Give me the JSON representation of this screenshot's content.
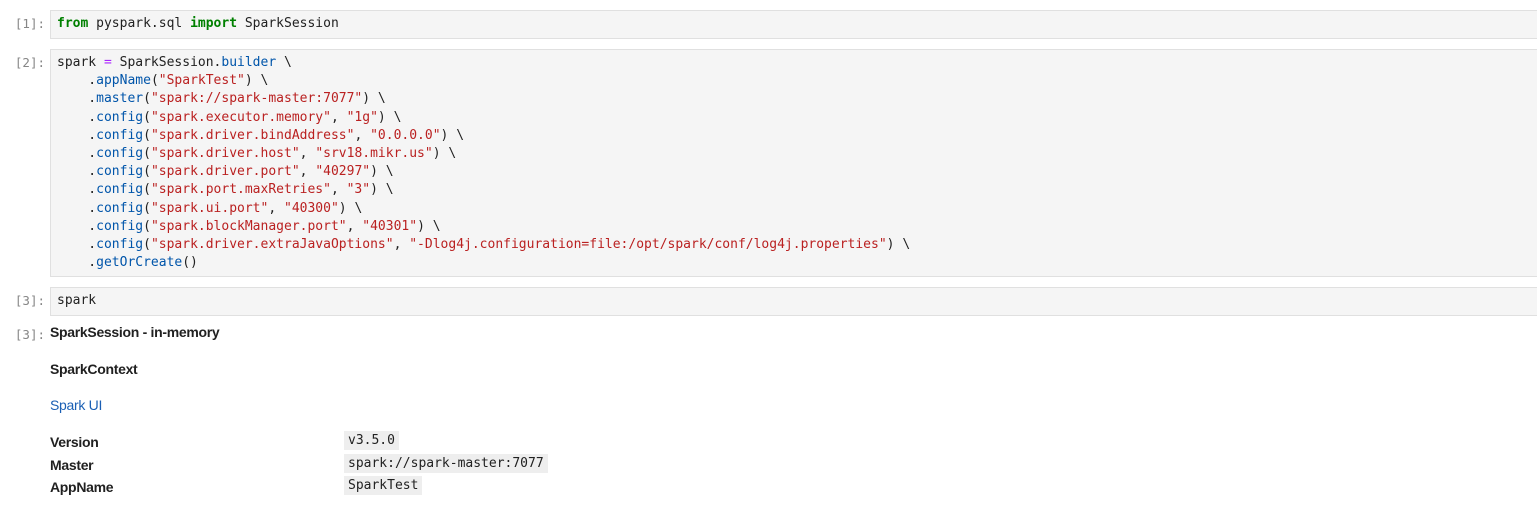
{
  "cells": [
    {
      "prompt": "[1]:",
      "tokens": [
        {
          "t": "kw",
          "v": "from"
        },
        {
          "t": "",
          "v": " pyspark.sql "
        },
        {
          "t": "kw",
          "v": "import"
        },
        {
          "t": "",
          "v": " SparkSession"
        }
      ]
    },
    {
      "prompt": "[2]:",
      "lines": [
        [
          {
            "t": "",
            "v": "spark "
          },
          {
            "t": "op",
            "v": "="
          },
          {
            "t": "",
            "v": " SparkSession."
          },
          {
            "t": "at",
            "v": "builder"
          },
          {
            "t": "",
            "v": " \\"
          }
        ],
        [
          {
            "t": "",
            "v": "    ."
          },
          {
            "t": "at",
            "v": "appName"
          },
          {
            "t": "",
            "v": "("
          },
          {
            "t": "st",
            "v": "\"SparkTest\""
          },
          {
            "t": "",
            "v": ") \\"
          }
        ],
        [
          {
            "t": "",
            "v": "    ."
          },
          {
            "t": "at",
            "v": "master"
          },
          {
            "t": "",
            "v": "("
          },
          {
            "t": "st",
            "v": "\"spark://spark-master:7077\""
          },
          {
            "t": "",
            "v": ") \\"
          }
        ],
        [
          {
            "t": "",
            "v": "    ."
          },
          {
            "t": "at",
            "v": "config"
          },
          {
            "t": "",
            "v": "("
          },
          {
            "t": "st",
            "v": "\"spark.executor.memory\""
          },
          {
            "t": "",
            "v": ", "
          },
          {
            "t": "st",
            "v": "\"1g\""
          },
          {
            "t": "",
            "v": ") \\"
          }
        ],
        [
          {
            "t": "",
            "v": "    ."
          },
          {
            "t": "at",
            "v": "config"
          },
          {
            "t": "",
            "v": "("
          },
          {
            "t": "st",
            "v": "\"spark.driver.bindAddress\""
          },
          {
            "t": "",
            "v": ", "
          },
          {
            "t": "st",
            "v": "\"0.0.0.0\""
          },
          {
            "t": "",
            "v": ") \\"
          }
        ],
        [
          {
            "t": "",
            "v": "    ."
          },
          {
            "t": "at",
            "v": "config"
          },
          {
            "t": "",
            "v": "("
          },
          {
            "t": "st",
            "v": "\"spark.driver.host\""
          },
          {
            "t": "",
            "v": ", "
          },
          {
            "t": "st",
            "v": "\"srv18.mikr.us\""
          },
          {
            "t": "",
            "v": ") \\"
          }
        ],
        [
          {
            "t": "",
            "v": "    ."
          },
          {
            "t": "at",
            "v": "config"
          },
          {
            "t": "",
            "v": "("
          },
          {
            "t": "st",
            "v": "\"spark.driver.port\""
          },
          {
            "t": "",
            "v": ", "
          },
          {
            "t": "st",
            "v": "\"40297\""
          },
          {
            "t": "",
            "v": ") \\"
          }
        ],
        [
          {
            "t": "",
            "v": "    ."
          },
          {
            "t": "at",
            "v": "config"
          },
          {
            "t": "",
            "v": "("
          },
          {
            "t": "st",
            "v": "\"spark.port.maxRetries\""
          },
          {
            "t": "",
            "v": ", "
          },
          {
            "t": "st",
            "v": "\"3\""
          },
          {
            "t": "",
            "v": ") \\"
          }
        ],
        [
          {
            "t": "",
            "v": "    ."
          },
          {
            "t": "at",
            "v": "config"
          },
          {
            "t": "",
            "v": "("
          },
          {
            "t": "st",
            "v": "\"spark.ui.port\""
          },
          {
            "t": "",
            "v": ", "
          },
          {
            "t": "st",
            "v": "\"40300\""
          },
          {
            "t": "",
            "v": ") \\"
          }
        ],
        [
          {
            "t": "",
            "v": "    ."
          },
          {
            "t": "at",
            "v": "config"
          },
          {
            "t": "",
            "v": "("
          },
          {
            "t": "st",
            "v": "\"spark.blockManager.port\""
          },
          {
            "t": "",
            "v": ", "
          },
          {
            "t": "st",
            "v": "\"40301\""
          },
          {
            "t": "",
            "v": ") \\"
          }
        ],
        [
          {
            "t": "",
            "v": "    ."
          },
          {
            "t": "at",
            "v": "config"
          },
          {
            "t": "",
            "v": "("
          },
          {
            "t": "st",
            "v": "\"spark.driver.extraJavaOptions\""
          },
          {
            "t": "",
            "v": ", "
          },
          {
            "t": "st",
            "v": "\"-Dlog4j.configuration=file:/opt/spark/conf/log4j.properties\""
          },
          {
            "t": "",
            "v": ") \\"
          }
        ],
        [
          {
            "t": "",
            "v": "    ."
          },
          {
            "t": "at",
            "v": "getOrCreate"
          },
          {
            "t": "",
            "v": "()"
          }
        ]
      ]
    },
    {
      "prompt": "[3]:",
      "tokens": [
        {
          "t": "",
          "v": "spark"
        }
      ]
    }
  ],
  "output": {
    "prompt": "[3]:",
    "title": "SparkSession - in-memory",
    "subtitle": "SparkContext",
    "link": "Spark UI",
    "rows": [
      {
        "key": "Version",
        "value": "v3.5.0"
      },
      {
        "key": "Master",
        "value": "spark://spark-master:7077"
      },
      {
        "key": "AppName",
        "value": "SparkTest"
      }
    ]
  },
  "colors": {
    "keyword": "#008000",
    "operator": "#aa22ff",
    "attribute": "#0055aa",
    "string": "#ba2121",
    "link": "#1a5fb4"
  }
}
